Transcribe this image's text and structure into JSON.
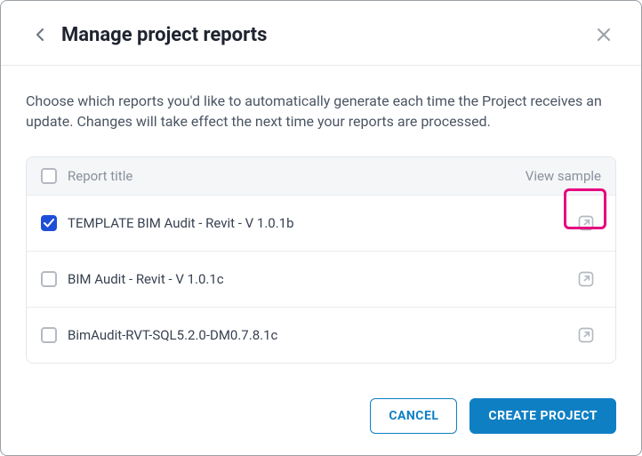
{
  "header": {
    "title": "Manage project reports"
  },
  "body": {
    "description": "Choose which reports you'd like to automatically generate each time the Project receives an update. Changes will take effect the next time your reports are processed."
  },
  "table": {
    "header": {
      "title_col": "Report title",
      "sample_col": "View sample"
    },
    "rows": [
      {
        "title": "TEMPLATE BIM Audit - Revit - V 1.0.1b",
        "checked": true,
        "highlighted": true
      },
      {
        "title": "BIM Audit - Revit - V 1.0.1c",
        "checked": false,
        "highlighted": false
      },
      {
        "title": "BimAudit-RVT-SQL5.2.0-DM0.7.8.1c",
        "checked": false,
        "highlighted": false
      }
    ]
  },
  "footer": {
    "cancel": "CANCEL",
    "create": "CREATE PROJECT"
  }
}
